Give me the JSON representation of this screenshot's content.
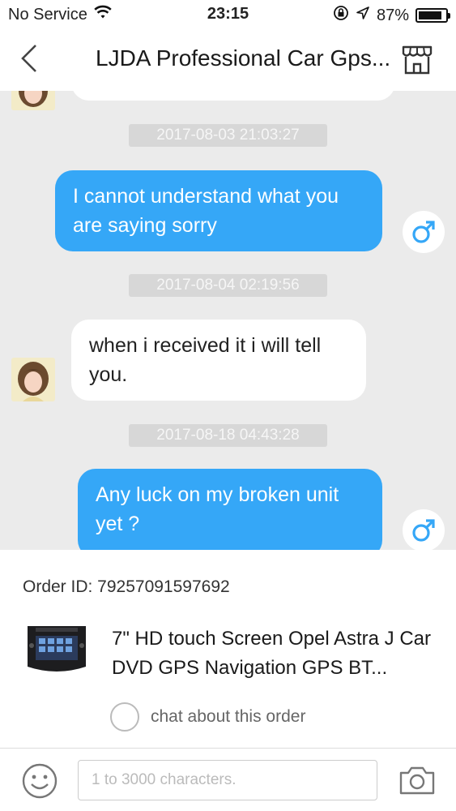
{
  "status_bar": {
    "carrier": "No Service",
    "time": "23:15",
    "battery_percent": "87%",
    "battery_level": 0.87
  },
  "nav": {
    "title": "LJDA Professional Car Gps..."
  },
  "messages": [
    {
      "timestamp": "2017-08-03 21:03:27",
      "direction": "out",
      "text": "I cannot understand what you are saying sorry"
    },
    {
      "timestamp": "2017-08-04 02:19:56",
      "direction": "in",
      "text": "when i received it i will tell you."
    },
    {
      "timestamp": "2017-08-18 04:43:28",
      "direction": "out",
      "text": "Any luck on my broken unit yet ?"
    }
  ],
  "order": {
    "id_label": "Order ID: 79257091597692",
    "product_title": "7\" HD touch Screen Opel Astra J Car DVD GPS Navigation GPS BT...",
    "chat_about_label": "chat about this order"
  },
  "input": {
    "placeholder": "1 to 3000 characters."
  },
  "colors": {
    "outgoing_bubble": "#35a7f7",
    "chat_background": "#ebebeb",
    "male_avatar_icon": "#35a7f7"
  }
}
